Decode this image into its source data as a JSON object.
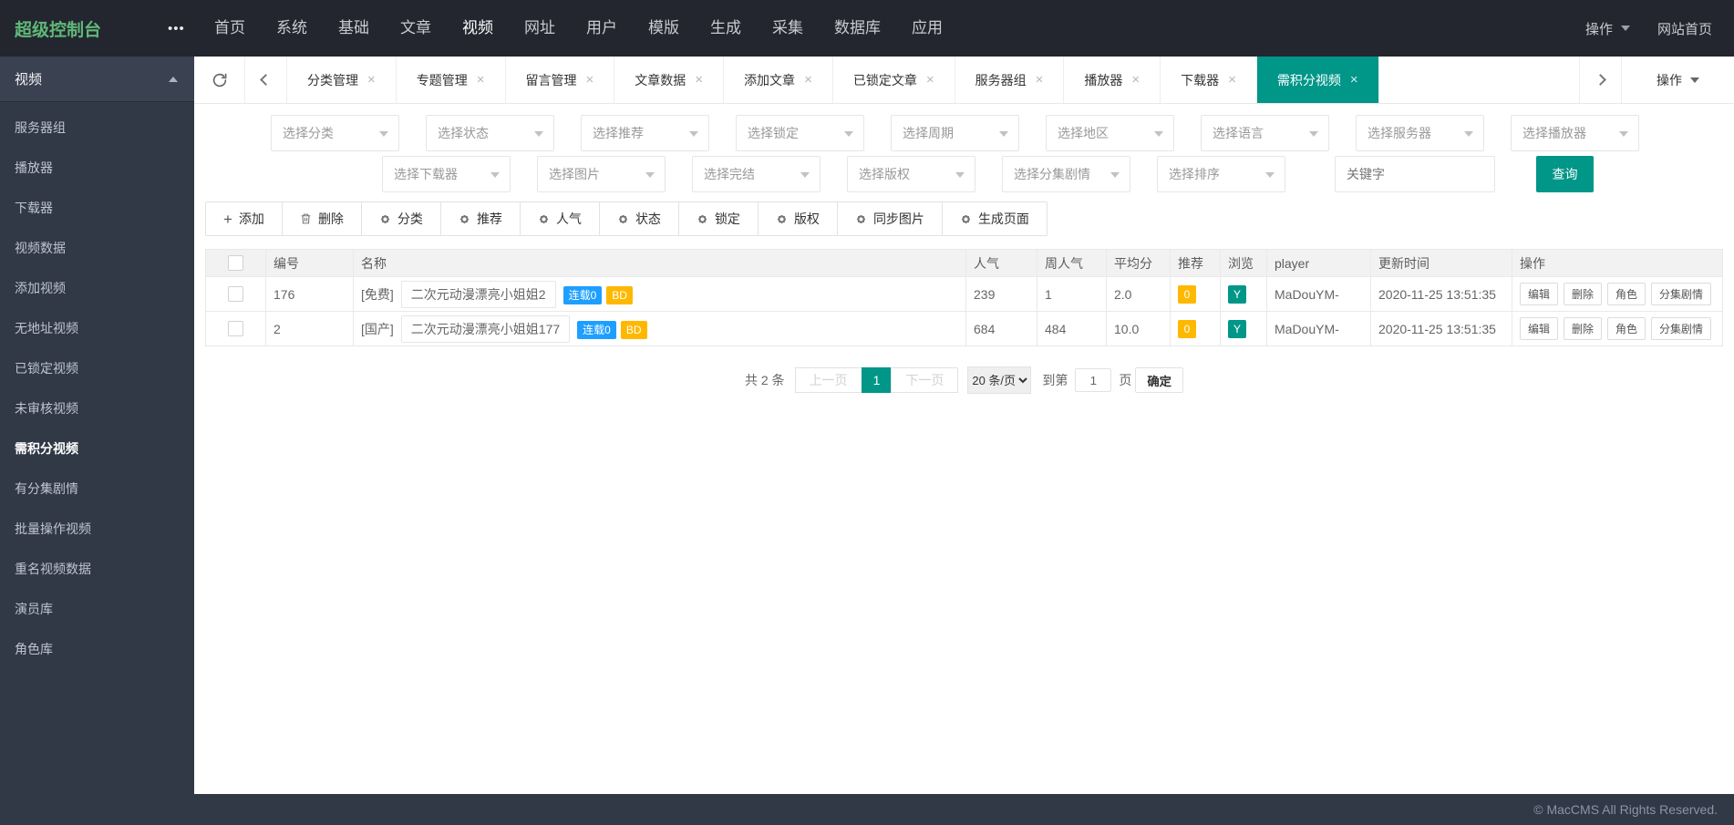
{
  "colors": {
    "accent": "#009688",
    "brand_green": "#5FB878",
    "badge_blue": "#1E9FFF",
    "badge_orange": "#FFB800"
  },
  "topbar": {
    "logo": "超级控制台",
    "more_icon_glyph": "•••",
    "nav_items": [
      {
        "label": "首页"
      },
      {
        "label": "系统"
      },
      {
        "label": "基础"
      },
      {
        "label": "文章"
      },
      {
        "label": "视频",
        "active": true
      },
      {
        "label": "网址"
      },
      {
        "label": "用户"
      },
      {
        "label": "模版"
      },
      {
        "label": "生成"
      },
      {
        "label": "采集"
      },
      {
        "label": "数据库"
      },
      {
        "label": "应用"
      }
    ],
    "action_label": "操作",
    "site_home_label": "网站首页"
  },
  "sidebar": {
    "header_label": "视频",
    "items": [
      {
        "label": "服务器组"
      },
      {
        "label": "播放器"
      },
      {
        "label": "下载器"
      },
      {
        "label": "视频数据"
      },
      {
        "label": "添加视频"
      },
      {
        "label": "无地址视频"
      },
      {
        "label": "已锁定视频"
      },
      {
        "label": "未审核视频"
      },
      {
        "label": "需积分视频",
        "active": true
      },
      {
        "label": "有分集剧情"
      },
      {
        "label": "批量操作视频"
      },
      {
        "label": "重名视频数据"
      },
      {
        "label": "演员库"
      },
      {
        "label": "角色库"
      }
    ]
  },
  "tabbar": {
    "tabs": [
      {
        "label": "分类管理"
      },
      {
        "label": "专题管理"
      },
      {
        "label": "留言管理"
      },
      {
        "label": "文章数据"
      },
      {
        "label": "添加文章"
      },
      {
        "label": "已锁定文章"
      },
      {
        "label": "服务器组"
      },
      {
        "label": "播放器"
      },
      {
        "label": "下载器"
      },
      {
        "label": "需积分视频",
        "active": true
      }
    ],
    "close_glyph": "×",
    "action_label": "操作"
  },
  "filters": {
    "row1": [
      "选择分类",
      "选择状态",
      "选择推荐",
      "选择锁定",
      "选择周期",
      "选择地区",
      "选择语言",
      "选择服务器",
      "选择播放器"
    ],
    "row2": [
      "选择下载器",
      "选择图片",
      "选择完结",
      "选择版权",
      "选择分集剧情",
      "选择排序"
    ],
    "keyword_placeholder": "关键字",
    "search_label": "查询"
  },
  "toolbar": {
    "buttons": [
      {
        "name": "add-button",
        "icon": "plus",
        "label": "添加"
      },
      {
        "name": "delete-button",
        "icon": "trash",
        "label": "删除"
      },
      {
        "name": "category-button",
        "icon": "gear",
        "label": "分类"
      },
      {
        "name": "recommend-button",
        "icon": "gear",
        "label": "推荐"
      },
      {
        "name": "hits-button",
        "icon": "gear",
        "label": "人气"
      },
      {
        "name": "status-button",
        "icon": "gear",
        "label": "状态"
      },
      {
        "name": "lock-button",
        "icon": "gear",
        "label": "锁定"
      },
      {
        "name": "copyright-button",
        "icon": "gear",
        "label": "版权"
      },
      {
        "name": "sync-images-button",
        "icon": "gear",
        "label": "同步图片"
      },
      {
        "name": "generate-pages-button",
        "icon": "gear",
        "label": "生成页面"
      }
    ]
  },
  "table": {
    "columns": [
      "编号",
      "名称",
      "人气",
      "周人气",
      "平均分",
      "推荐",
      "浏览",
      "player",
      "更新时间",
      "操作"
    ],
    "row_actions": [
      {
        "name": "edit-button",
        "label": "编辑"
      },
      {
        "name": "delete-button",
        "label": "删除"
      },
      {
        "name": "role-button",
        "label": "角色"
      },
      {
        "name": "episodes-button",
        "label": "分集剧情"
      }
    ],
    "rows": [
      {
        "id": "176",
        "prefix": "[免费]",
        "title": "二次元动漫漂亮小姐姐2",
        "badges": [
          {
            "label": "连载0",
            "color": "#1E9FFF"
          },
          {
            "label": "BD",
            "color": "#FFB800"
          }
        ],
        "hits": "239",
        "weekly_hits": "1",
        "score": "2.0",
        "recommend": "0",
        "browse": "Y",
        "player": "MaDouYM-",
        "updated": "2020-11-25 13:51:35"
      },
      {
        "id": "2",
        "prefix": "[国产]",
        "title": "二次元动漫漂亮小姐姐177",
        "badges": [
          {
            "label": "连载0",
            "color": "#1E9FFF"
          },
          {
            "label": "BD",
            "color": "#FFB800"
          }
        ],
        "hits": "684",
        "weekly_hits": "484",
        "score": "10.0",
        "recommend": "0",
        "browse": "Y",
        "player": "MaDouYM-",
        "updated": "2020-11-25 13:51:35"
      }
    ]
  },
  "pagination": {
    "total_text": "共 2 条",
    "prev_label": "上一页",
    "current_page": "1",
    "next_label": "下一页",
    "page_size_label": "20 条/页",
    "goto_prefix": "到第",
    "goto_value": "1",
    "goto_suffix": "页",
    "confirm_label": "确定"
  },
  "footer": {
    "copyright": "© MacCMS All Rights Reserved."
  }
}
